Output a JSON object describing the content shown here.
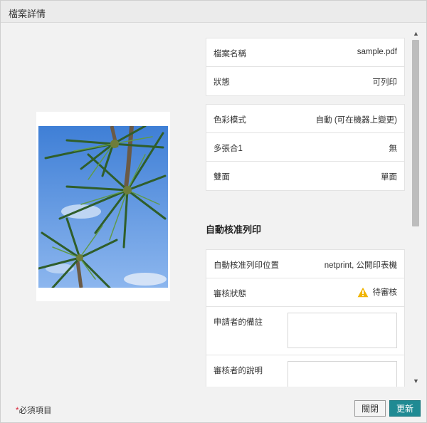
{
  "dialog": {
    "title": "檔案詳情"
  },
  "file": {
    "rows": [
      {
        "label": "檔案名稱",
        "value": "sample.pdf"
      },
      {
        "label": "狀態",
        "value": "可列印"
      }
    ]
  },
  "settings": {
    "rows": [
      {
        "label": "色彩模式",
        "value": "自動 (可在機器上變更)"
      },
      {
        "label": "多張合1",
        "value": "無"
      },
      {
        "label": "雙面",
        "value": "單面"
      }
    ]
  },
  "auto_approval": {
    "title": "自動核准列印",
    "location_label": "自動核准列印位置",
    "location_value": "netprint, 公開印表機",
    "status_label": "審核狀態",
    "status_value": "待審核",
    "status_icon": "warning-icon",
    "applicant_note_label": "申請者的備註",
    "reviewer_note_label": "審核者的說明"
  },
  "footer": {
    "required_star": "*",
    "required_text": "必須項目",
    "close_label": "關閉",
    "update_label": "更新"
  },
  "colors": {
    "accent": "#1f8a93",
    "warning": "#f0b400",
    "required": "#d9263a"
  }
}
